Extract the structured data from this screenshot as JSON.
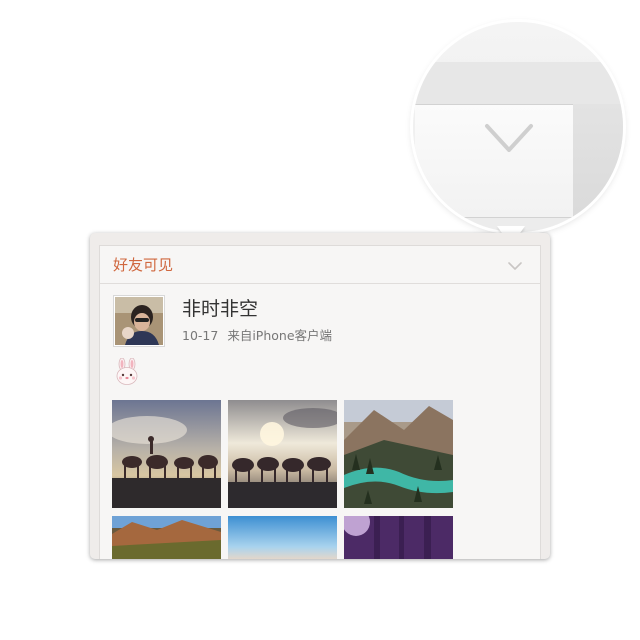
{
  "post": {
    "visibility": "好友可见",
    "username": "非时非空",
    "date": "10-17",
    "source": "来自iPhone客户端",
    "emoji": "rabbit-emoji"
  },
  "photos": [
    {
      "subject": "camel-caravan-sunset"
    },
    {
      "subject": "camel-caravan-sky"
    },
    {
      "subject": "river-valley"
    },
    {
      "subject": "autumn-mountains"
    },
    {
      "subject": "blue-sky-horizon"
    },
    {
      "subject": "purple-forest-sunlight"
    }
  ],
  "colors": {
    "accent": "#d0683f",
    "card_bg": "#f7f6f5",
    "text_primary": "#333333",
    "text_secondary": "#777777"
  }
}
